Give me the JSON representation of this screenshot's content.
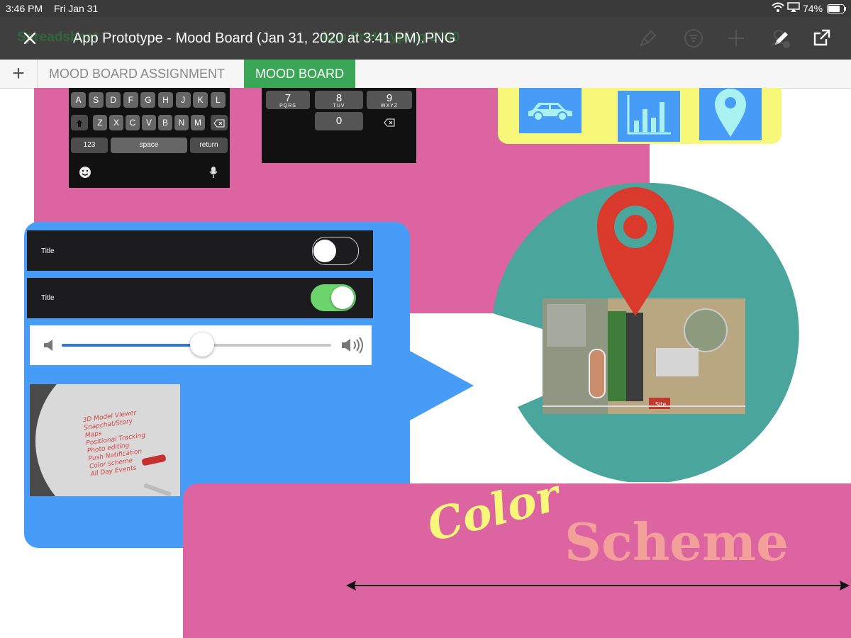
{
  "status_bar": {
    "time": "3:46 PM",
    "date": "Fri Jan 31",
    "battery": "74%"
  },
  "title_bar": {
    "ghost_left": "Spreadsheet",
    "ghost_center": "App Prototyping 2020",
    "title": "App Prototype - Mood Board (Jan 31, 2020 at 3:41 PM).PNG"
  },
  "sheet_tabs": {
    "add_label": "+",
    "tabs": [
      "MOOD BOARD ASSIGNMENT",
      "MOOD BOARD"
    ],
    "active_index": 1
  },
  "keyboard": {
    "row2": [
      "A",
      "S",
      "D",
      "F",
      "G",
      "H",
      "J",
      "K",
      "L"
    ],
    "row3": [
      "Z",
      "X",
      "C",
      "V",
      "B",
      "N",
      "M"
    ],
    "num_key": "123",
    "space_key": "space",
    "return_key": "return"
  },
  "numpad": {
    "keys": [
      {
        "digit": "7",
        "letters": "PQRS"
      },
      {
        "digit": "8",
        "letters": "TUV"
      },
      {
        "digit": "9",
        "letters": "WXYZ"
      },
      {
        "digit": "0",
        "letters": ""
      }
    ]
  },
  "settings_rows": [
    {
      "label": "Title",
      "toggle_on": false
    },
    {
      "label": "Title",
      "toggle_on": true
    }
  ],
  "volume_slider": {
    "value": 0.52
  },
  "whiteboard_lines": [
    "3D Model Viewer",
    "Snapchat/Story",
    "Maps",
    "Positional Tracking",
    "Photo editing",
    "Push Notification",
    "Color scheme",
    "All Day Events"
  ],
  "color_scheme_heading": {
    "word1": "Color",
    "word2": "Scheme"
  },
  "colors": {
    "pink": "#dc65a1",
    "blue": "#479cf7",
    "teal": "#4aa59d",
    "yellow": "#f7f77a",
    "pin_red": "#d93a2b",
    "salmon": "#f3a09a",
    "toggle_green": "#6bd46b"
  },
  "map_labels": {
    "site": "Site"
  },
  "icons": [
    "close-icon",
    "paint-brush-icon",
    "filter-icon",
    "plus-icon",
    "collaborate-icon",
    "share-icon",
    "car-icon",
    "bar-chart-icon",
    "location-pin-icon",
    "speaker-low-icon",
    "speaker-high-icon",
    "emoji-icon",
    "microphone-icon",
    "shift-icon",
    "delete-icon"
  ]
}
